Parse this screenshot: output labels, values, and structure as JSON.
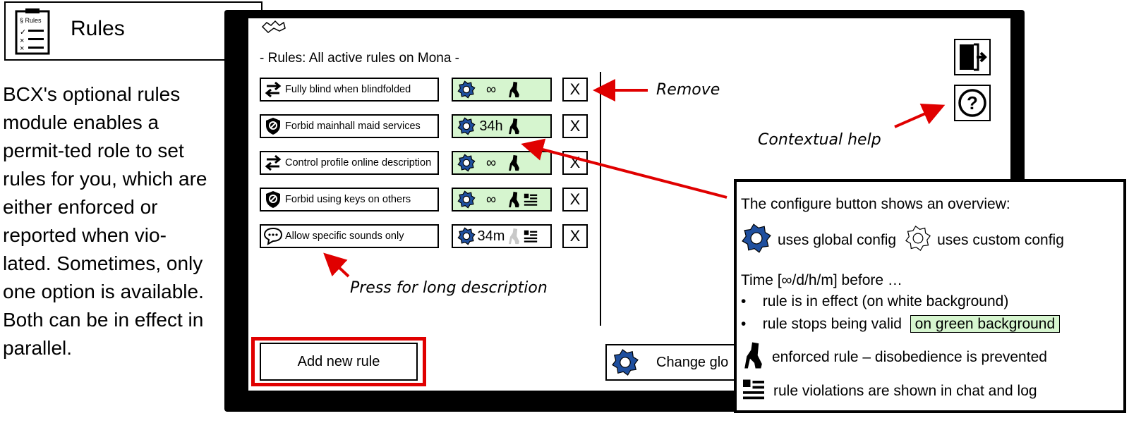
{
  "title": "Rules",
  "title_icon": "rules-clipboard-icon",
  "title_icon_text": "§ Rules",
  "description": "BCX's optional rules module enables a permit-ted role to set rules for you, which are either enforced or reported when vio-lated. Sometimes, only one option is available. Both can be in effect in parallel.",
  "screen": {
    "header": "- Rules: All active rules on Mona -",
    "rules": [
      {
        "name": "Fully blind when blindfolded",
        "icon": "swap-arrows-icon",
        "time": "∞",
        "state": "green",
        "enforced": true,
        "logged": false
      },
      {
        "name": "Forbid mainhall maid services",
        "icon": "forbid-shield-icon",
        "time": "34h",
        "state": "green",
        "enforced": true,
        "logged": false
      },
      {
        "name": "Control profile online description",
        "icon": "swap-arrows-icon",
        "time": "∞",
        "state": "green",
        "enforced": true,
        "logged": false
      },
      {
        "name": "Forbid using keys on others",
        "icon": "forbid-shield-icon",
        "time": "∞",
        "state": "green",
        "enforced": true,
        "logged": true
      },
      {
        "name": "Allow specific sounds only",
        "icon": "speech-bubble-icon",
        "time": "34m",
        "state": "white",
        "enforced": false,
        "logged": true
      }
    ],
    "remove_label": "X",
    "add_button": "Add new rule",
    "global_button": "Change glo"
  },
  "annotations": {
    "remove": "Remove",
    "help": "Contextual help",
    "press": "Press for long description"
  },
  "overview": {
    "title": "The configure button shows an overview:",
    "global_config": "uses global config",
    "custom_config": "uses custom config",
    "time_intro": "Time [∞/d/h/m] before …",
    "bullet1": "rule is in effect (on white background)",
    "bullet2_prefix": "rule stops being valid",
    "bullet2_green": "on green background",
    "enforced": "enforced rule – disobedience is prevented",
    "logged": "rule violations are shown in chat and log"
  },
  "colors": {
    "green_bg": "#d6f5cf",
    "highlight_red": "#e00000",
    "gear_blue": "#1f4f9e"
  }
}
